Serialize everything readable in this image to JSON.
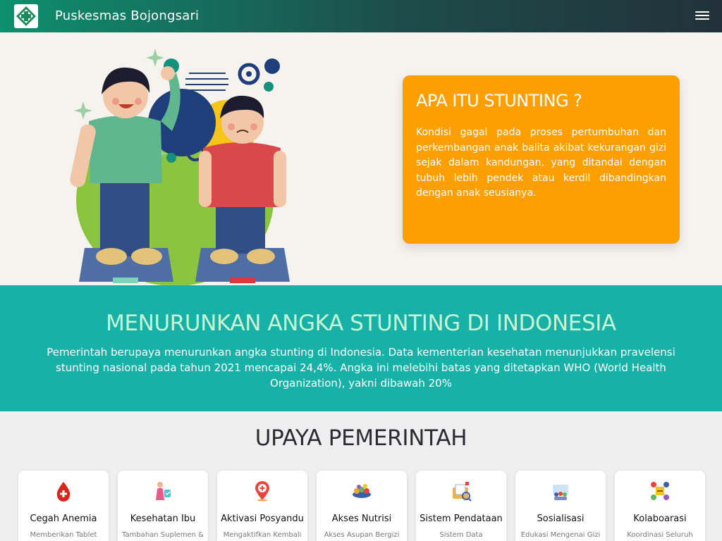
{
  "navbar": {
    "brand": "Puskesmas Bojongsari",
    "logo_icon": "puskesmas-cross-logo",
    "menu_icon": "hamburger-menu-icon"
  },
  "hero": {
    "illustration": "two-children-height-comparison",
    "card": {
      "title": "APA ITU STUNTING ?",
      "text": "Kondisi gagal pada proses pertumbuhan dan perkembangan anak balita akibat kekurangan gizi sejak dalam kandungan, yang ditandai dengan tubuh lebih pendek atau kerdil dibandingkan dengan anak seusianya."
    }
  },
  "band": {
    "title": "MENURUNKAN ANGKA STUNTING DI INDONESIA",
    "text": "Pemerintah berupaya menurunkan angka stunting di Indonesia. Data kementerian kesehatan menunjukkan pravelensi stunting nasional pada tahun 2021 mencapai 24,4%. Angka ini melebihi batas yang ditetapkan WHO (World Health Organization), yakni dibawah 20%"
  },
  "upaya": {
    "title": "UPAYA PEMERINTAH",
    "items": [
      {
        "title": "Cegah Anemia",
        "desc": "Memberikan Tablet",
        "icon": "blood-drop-icon"
      },
      {
        "title": "Kesehatan Ibu",
        "desc": "Tambahan Suplemen &",
        "icon": "mother-child-icon"
      },
      {
        "title": "Aktivasi Posyandu",
        "desc": "Mengaktifkan Kembali",
        "icon": "location-pin-icon"
      },
      {
        "title": "Akses Nutrisi",
        "desc": "Akses Asupan Bergizi",
        "icon": "nutrition-food-icon"
      },
      {
        "title": "Sistem Pendataan",
        "desc": "Sistem Data",
        "icon": "data-folder-icon"
      },
      {
        "title": "Sosialisasi",
        "desc": "Edukasi Mengenai Gizi",
        "icon": "community-icon"
      },
      {
        "title": "Kolaboarasi",
        "desc": "Koordinasi Seluruh",
        "icon": "collaboration-icon"
      }
    ]
  },
  "colors": {
    "nav_start": "#0e8f6e",
    "nav_end": "#22313a",
    "hero_bg": "#f6f3ee",
    "card_bg": "#fe9f01",
    "band_bg": "#17b1a7",
    "band_title": "#c8f6d4",
    "section_bg": "#efefef"
  }
}
